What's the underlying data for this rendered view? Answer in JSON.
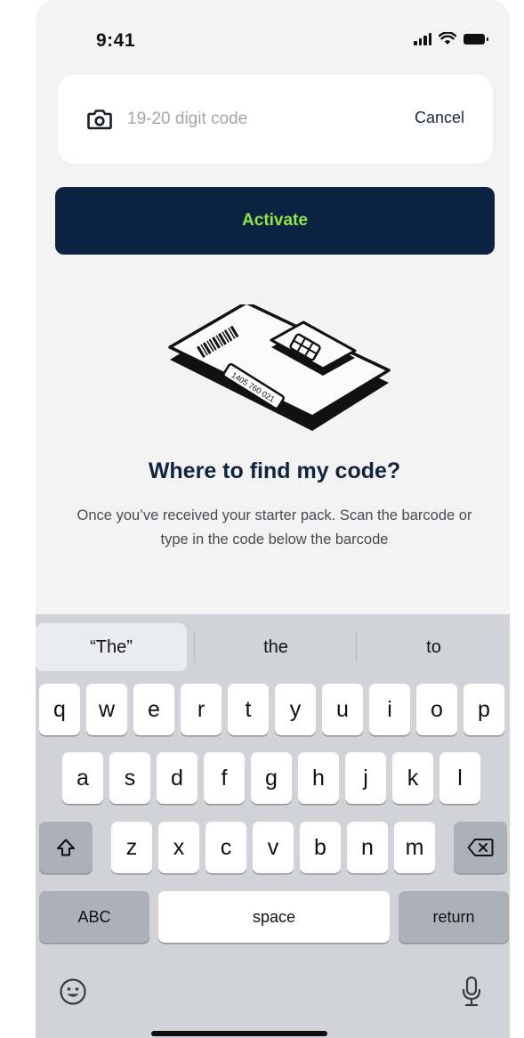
{
  "status_bar": {
    "time": "9:41"
  },
  "code_field": {
    "placeholder": "19-20 digit code",
    "value": "",
    "cancel_label": "Cancel"
  },
  "activate_label": "Activate",
  "illustration": {
    "code_text": "1405 760 021"
  },
  "help": {
    "title": "Where to find my code?",
    "text": "Once you’ve received your starter pack. Scan the barcode or type in the code below the barcode"
  },
  "keyboard": {
    "suggestions": [
      "“The”",
      "the",
      "to"
    ],
    "row1": [
      "q",
      "w",
      "e",
      "r",
      "t",
      "y",
      "u",
      "i",
      "o",
      "p"
    ],
    "row2": [
      "a",
      "s",
      "d",
      "f",
      "g",
      "h",
      "j",
      "k",
      "l"
    ],
    "row3": [
      "z",
      "x",
      "c",
      "v",
      "b",
      "n",
      "m"
    ],
    "abc_label": "ABC",
    "space_label": "space",
    "return_label": "return"
  },
  "colors": {
    "navy": "#0b2240",
    "accent_green": "#8fe54a",
    "background": "#f3f3f4"
  }
}
